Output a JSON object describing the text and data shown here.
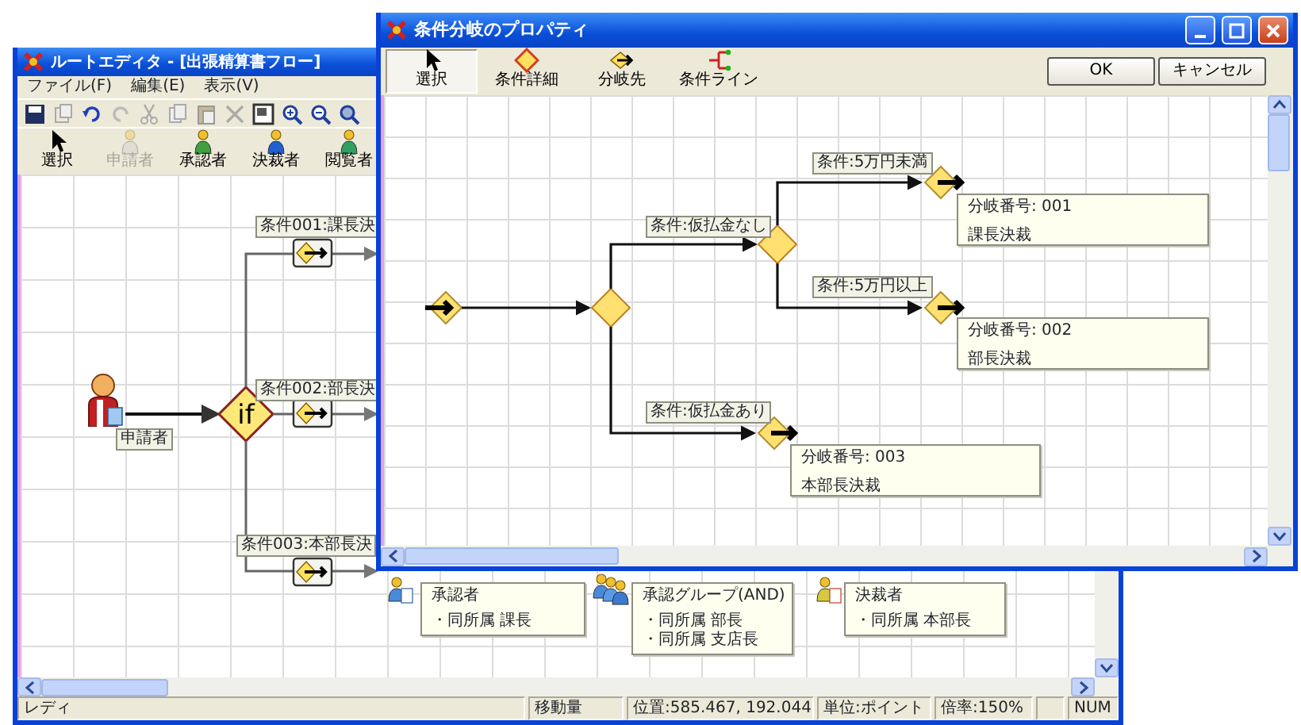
{
  "editor_window": {
    "title": "ルートエディタ - [出張精算書フロー]",
    "menu": [
      "ファイル(F)",
      "編集(E)",
      "表示(V)"
    ],
    "palette": [
      {
        "label": "選択",
        "kind": "cursor",
        "disabled": false
      },
      {
        "label": "申請者",
        "kind": "applicant",
        "disabled": true
      },
      {
        "label": "承認者",
        "kind": "approver",
        "disabled": false
      },
      {
        "label": "決裁者",
        "kind": "decider",
        "disabled": false
      },
      {
        "label": "閲覧者",
        "kind": "viewer",
        "disabled": false
      }
    ],
    "flow": {
      "applicant": "申請者",
      "decision": "if",
      "conditions": [
        "条件001:課長決",
        "条件002:部長決",
        "条件003:本部長決"
      ],
      "steps": [
        {
          "kind": "single",
          "title": "承認者",
          "members": [
            "・同所属 課長"
          ]
        },
        {
          "kind": "group",
          "title": "承認グループ(AND)",
          "members": [
            "・同所属 部長",
            "・同所属 支店長"
          ]
        },
        {
          "kind": "final",
          "title": "決裁者",
          "members": [
            "・同所属 本部長"
          ]
        }
      ]
    },
    "status_bar": [
      "レディ",
      "移動量",
      "位置:585.467, 192.044",
      "単位:ポイント",
      "倍率:150%",
      "NUM"
    ]
  },
  "properties_dialog": {
    "title": "条件分岐のプロパティ",
    "tools": [
      {
        "label": "選択",
        "kind": "cursor",
        "selected": true
      },
      {
        "label": "条件詳細",
        "kind": "detail",
        "selected": false
      },
      {
        "label": "分岐先",
        "kind": "target",
        "selected": false
      },
      {
        "label": "条件ライン",
        "kind": "line",
        "selected": false
      }
    ],
    "buttons": [
      "OK",
      "キャンセル"
    ],
    "branches": [
      {
        "condition": "条件:仮払金なし",
        "children": [
          {
            "condition": "条件:5万円未満",
            "number": "分岐番号: 001",
            "target": "課長決裁"
          },
          {
            "condition": "条件:5万円以上",
            "number": "分岐番号: 002",
            "target": "部長決裁"
          }
        ]
      },
      {
        "condition": "条件:仮払金あり",
        "number": "分岐番号: 003",
        "target": "本部長決裁"
      }
    ]
  }
}
